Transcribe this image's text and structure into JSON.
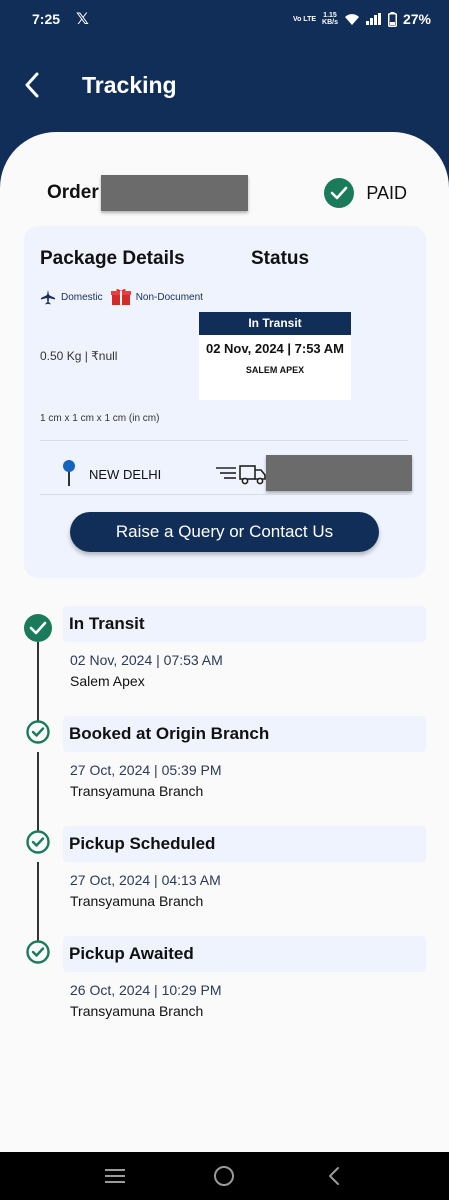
{
  "status_bar": {
    "time": "7:25",
    "volte_top": "Vo LTE",
    "speed_top": "1.15",
    "speed_bottom": "KB/s",
    "battery": "27%"
  },
  "header": {
    "title": "Tracking"
  },
  "order": {
    "label": "Order",
    "payment_status": "PAID"
  },
  "package": {
    "details_heading": "Package Details",
    "status_heading": "Status",
    "chip_domestic": "Domestic",
    "chip_type": "Non-Document",
    "weight_value": "0.50 Kg  |  ₹null",
    "dimensions": "1 cm x 1 cm x 1 cm (in cm)",
    "current_status": "In Transit",
    "status_datetime": "02 Nov, 2024 | 7:53 AM",
    "status_location": "SALEM APEX",
    "destination_city": "NEW DELHI",
    "query_button": "Raise a Query or Contact Us"
  },
  "timeline": [
    {
      "title": "In Transit",
      "date": "02 Nov, 2024 | 07:53 AM",
      "location": "Salem Apex"
    },
    {
      "title": "Booked at Origin Branch",
      "date": "27 Oct, 2024 | 05:39 PM",
      "location": "Transyamuna Branch"
    },
    {
      "title": "Pickup Scheduled",
      "date": "27 Oct, 2024 | 04:13 AM",
      "location": "Transyamuna Branch"
    },
    {
      "title": "Pickup Awaited",
      "date": "26 Oct, 2024 | 10:29 PM",
      "location": "Transyamuna Branch"
    }
  ],
  "colors": {
    "primary_navy": "#112e59",
    "success_green": "#1a7a5a",
    "card_bg": "#eef3fd"
  }
}
